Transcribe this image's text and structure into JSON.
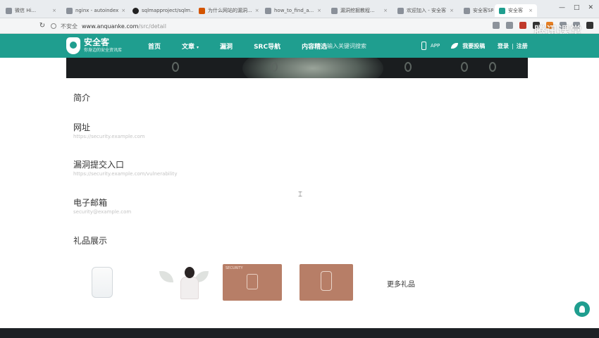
{
  "browser": {
    "tabs": [
      {
        "label": "微信 Hi...",
        "active": false
      },
      {
        "label": "nginx - autoindex",
        "active": false
      },
      {
        "label": "sqlmapproject/sqlm...",
        "active": false
      },
      {
        "label": "为什么网站的漏洞...",
        "active": false
      },
      {
        "label": "how_to_find_a...",
        "active": false
      },
      {
        "label": "漏洞挖掘教程...",
        "active": false
      },
      {
        "label": "欢迎加入 - 安全客",
        "active": false
      },
      {
        "label": "安全客SRC - ...",
        "active": false
      },
      {
        "label": "安全客",
        "active": true
      }
    ],
    "tab_close": "×",
    "window_controls": {
      "minimize": "—",
      "maximize": "□",
      "close": "✕"
    },
    "nav_reload_glyph": "↻",
    "address": {
      "security_label": "不安全",
      "url_main": "www.anquanke.com",
      "url_rest": "/src/detail"
    }
  },
  "watermark": "腾讯课堂",
  "site": {
    "logo": {
      "title": "安全客",
      "subtitle": "你身边的安全资讯库"
    },
    "nav": [
      {
        "label": "首页",
        "has_caret": false
      },
      {
        "label": "文章",
        "has_caret": true
      },
      {
        "label": "漏洞",
        "has_caret": false
      },
      {
        "label": "SRC导航",
        "has_caret": false
      },
      {
        "label": "内容精选",
        "has_caret": false
      }
    ],
    "nav_caret": "▾",
    "search_placeholder": "输入关键词搜索",
    "app_label": "APP",
    "contribute_label": "我要投稿",
    "login_label": "登录",
    "separator": "|",
    "register_label": "注册"
  },
  "sections": {
    "intro": {
      "title": "简介"
    },
    "website": {
      "title": "网址",
      "value": "https://security.example.com"
    },
    "vuln_entry": {
      "title": "漏洞提交入口",
      "value": "https://security.example.com/vulnerability"
    },
    "email": {
      "title": "电子邮箱",
      "value": "security@example.com"
    },
    "gifts": {
      "title": "礼品展示"
    }
  },
  "gifts": [
    {
      "name": "gift-1"
    },
    {
      "name": "gift-2"
    },
    {
      "name": "gift-3",
      "text": "SECURITY"
    },
    {
      "name": "gift-4"
    }
  ],
  "more_gifts_label": "更多礼品"
}
